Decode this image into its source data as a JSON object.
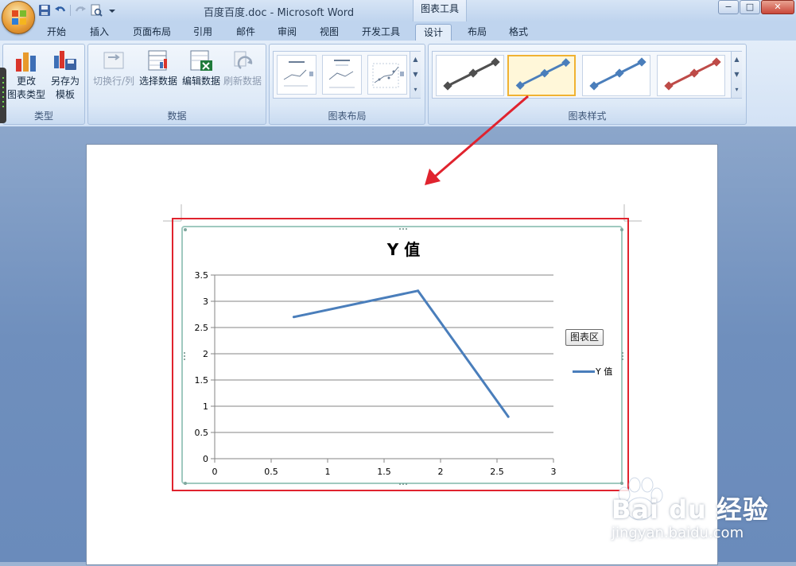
{
  "window": {
    "title": "百度百度.doc - Microsoft Word",
    "context_tool": "图表工具",
    "buttons": {
      "minimize": "−",
      "maximize": "□",
      "close": "✕"
    }
  },
  "quick_access": [
    "save-icon",
    "undo-icon",
    "redo-icon",
    "print-preview-icon",
    "customize-arrow-icon"
  ],
  "tabs": [
    {
      "label": "开始"
    },
    {
      "label": "插入"
    },
    {
      "label": "页面布局"
    },
    {
      "label": "引用"
    },
    {
      "label": "邮件"
    },
    {
      "label": "审阅"
    },
    {
      "label": "视图"
    },
    {
      "label": "开发工具"
    },
    {
      "label": "设计",
      "active": true
    },
    {
      "label": "布局"
    },
    {
      "label": "格式"
    }
  ],
  "ribbon": {
    "type_group": {
      "label": "类型",
      "change_type": "更改\n图表类型",
      "save_template": "另存为\n模板"
    },
    "data_group": {
      "label": "数据",
      "switch_row_col": "切换行/列",
      "select_data": "选择数据",
      "edit_data": "编辑数据",
      "refresh_data": "刷新数据"
    },
    "layout_group": {
      "label": "图表布局"
    },
    "styles_group": {
      "label": "图表样式",
      "style_colors": [
        "#4f4f4f",
        "#4a7ebb",
        "#4a7ebb",
        "#be4b48"
      ],
      "selected_index": 1
    }
  },
  "chart": {
    "tooltip": "图表区",
    "accent_line": "#4a7ebb",
    "frame_color": "#e0232e"
  },
  "chart_data": {
    "type": "line",
    "title": "Y 值",
    "series": [
      {
        "name": "Y 值",
        "x": [
          0.7,
          1.8,
          2.6
        ],
        "values": [
          2.7,
          3.2,
          0.8
        ],
        "color": "#4a7ebb"
      }
    ],
    "xlim": [
      0,
      3
    ],
    "ylim": [
      0,
      3.5
    ],
    "xticks": [
      "0",
      "0.5",
      "1",
      "1.5",
      "2",
      "2.5",
      "3"
    ],
    "yticks": [
      "0",
      "0.5",
      "1",
      "1.5",
      "2",
      "2.5",
      "3",
      "3.5"
    ],
    "grid": "horizontal",
    "legend": "right"
  },
  "watermark": {
    "brand": "Bai du 经验",
    "url": "jingyan.baidu.com"
  }
}
